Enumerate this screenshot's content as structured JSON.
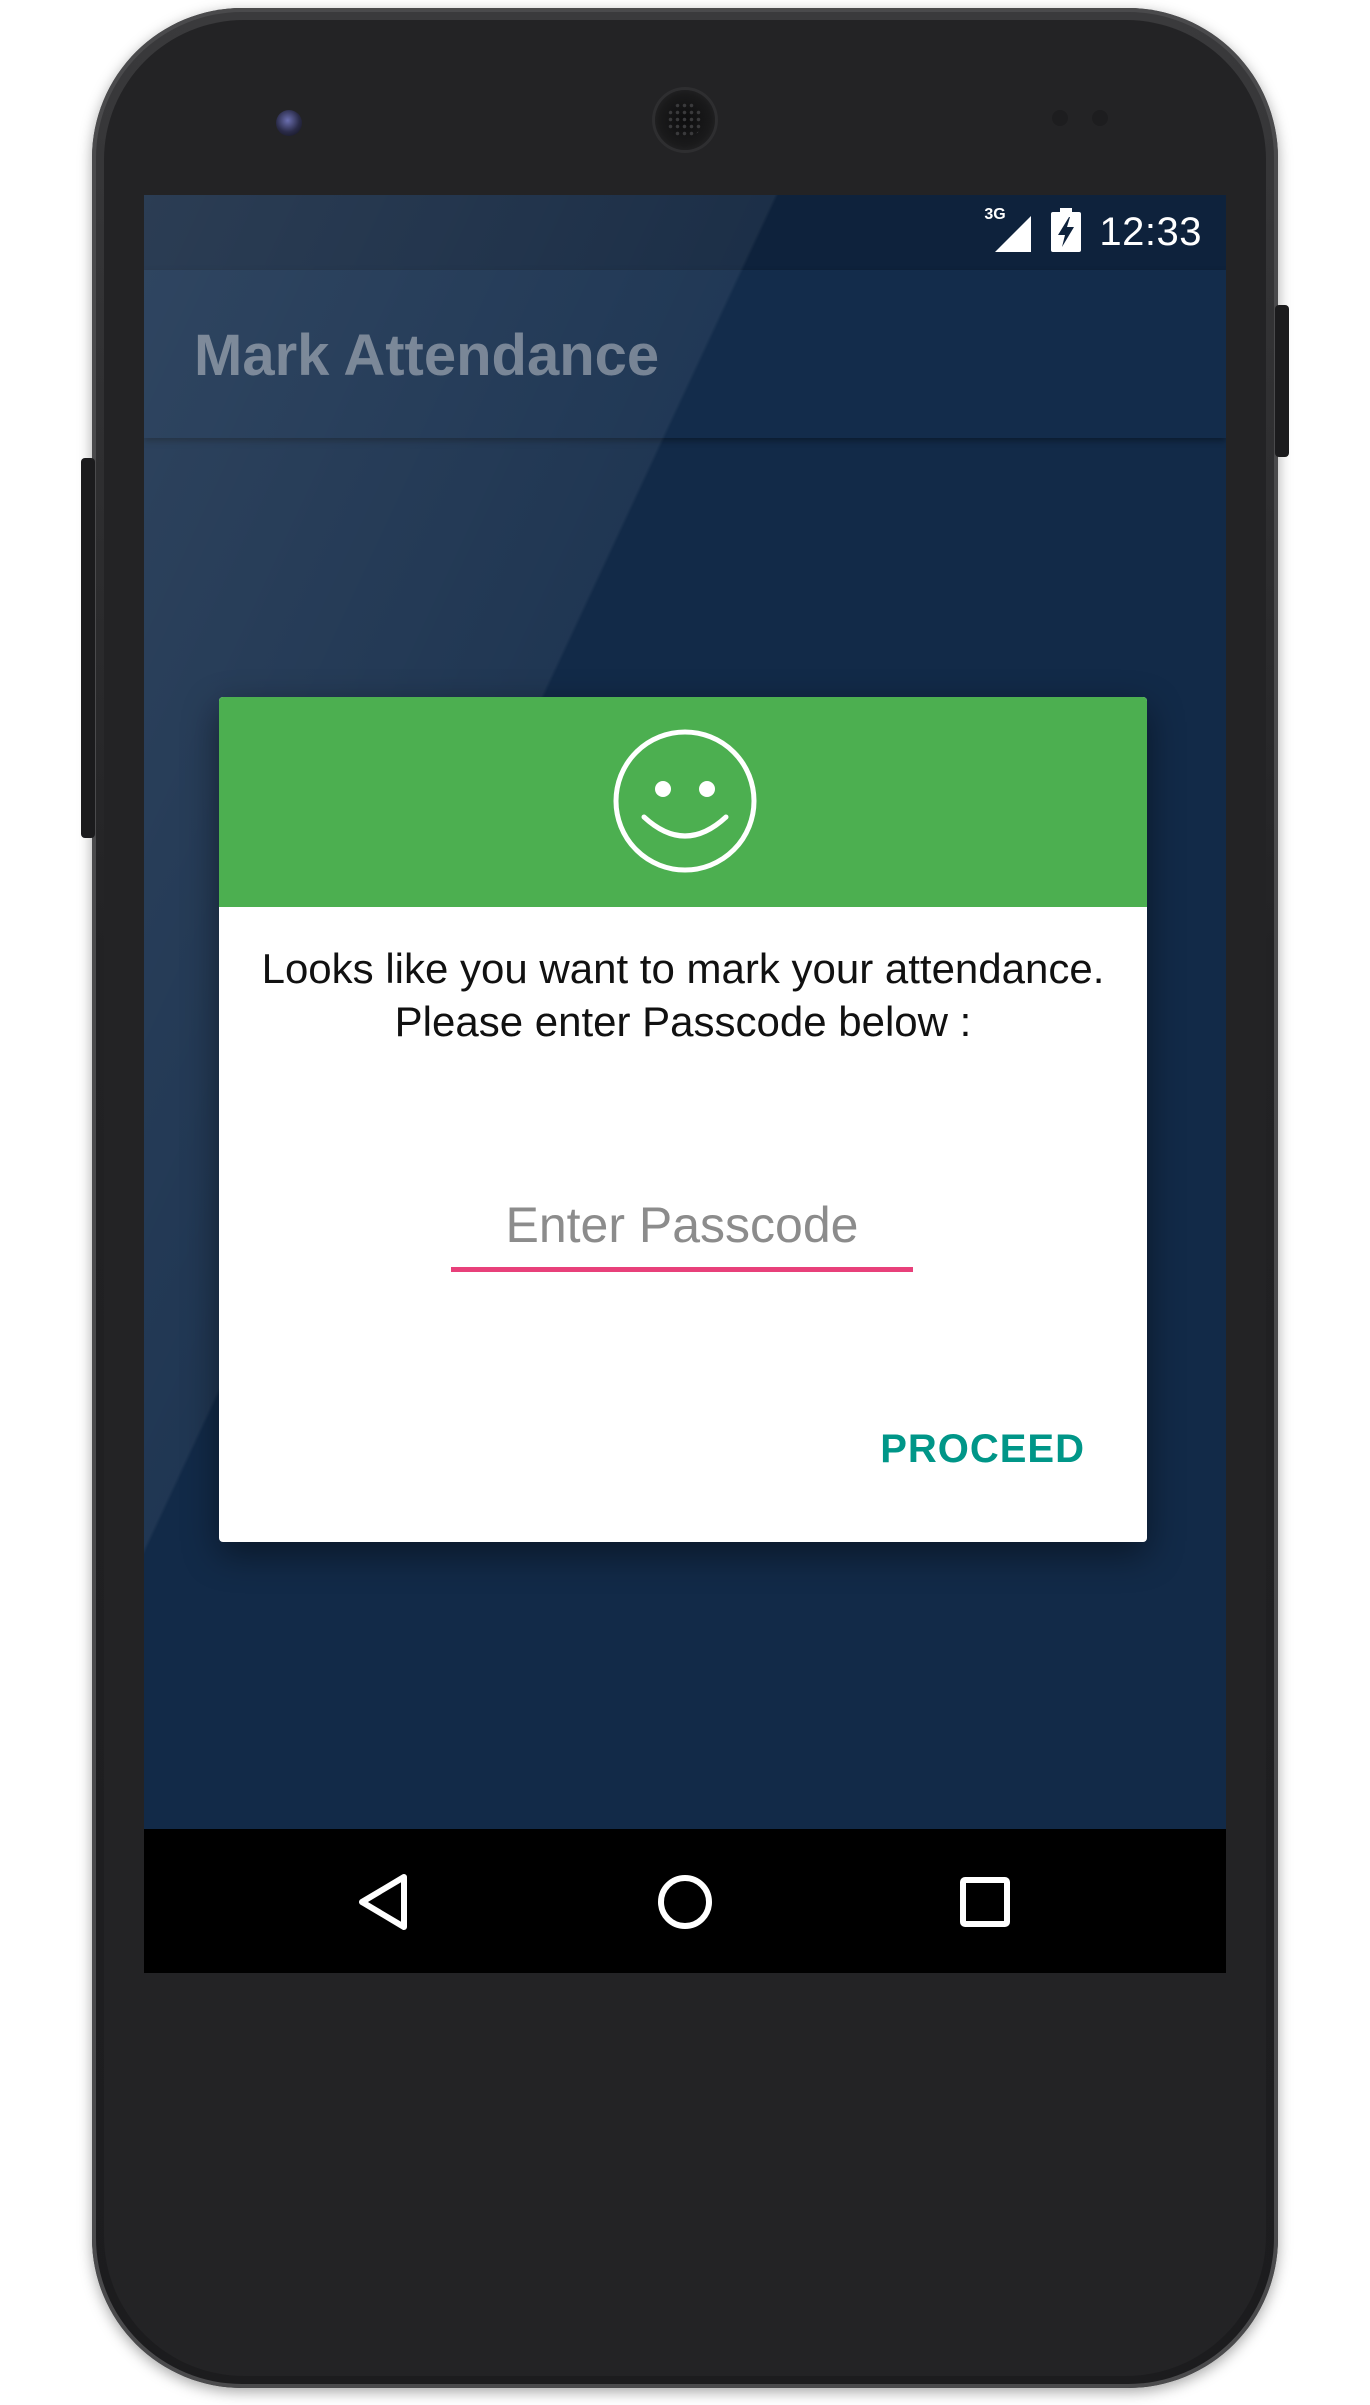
{
  "status_bar": {
    "network_type": "3G",
    "time": "12:33",
    "signal_icon": "signal-icon",
    "battery_icon": "battery-charging-icon"
  },
  "app_bar": {
    "title": "Mark Attendance"
  },
  "dialog": {
    "header_icon": "smiley-icon",
    "header_color": "#4caf50",
    "message_line1": "Looks like you want to mark your attendance.",
    "message_line2": "Please enter Passcode below :",
    "passcode": {
      "placeholder": "Enter Passcode",
      "value": "",
      "underline_color": "#e8407a"
    },
    "proceed_label": "PROCEED",
    "proceed_color": "#009688"
  },
  "nav_bar": {
    "back_icon": "back-triangle-icon",
    "home_icon": "home-circle-icon",
    "recents_icon": "recents-square-icon"
  },
  "colors": {
    "screen_background": "#122a48",
    "status_bar": "#0e223c",
    "app_bar": "#132c4b"
  }
}
